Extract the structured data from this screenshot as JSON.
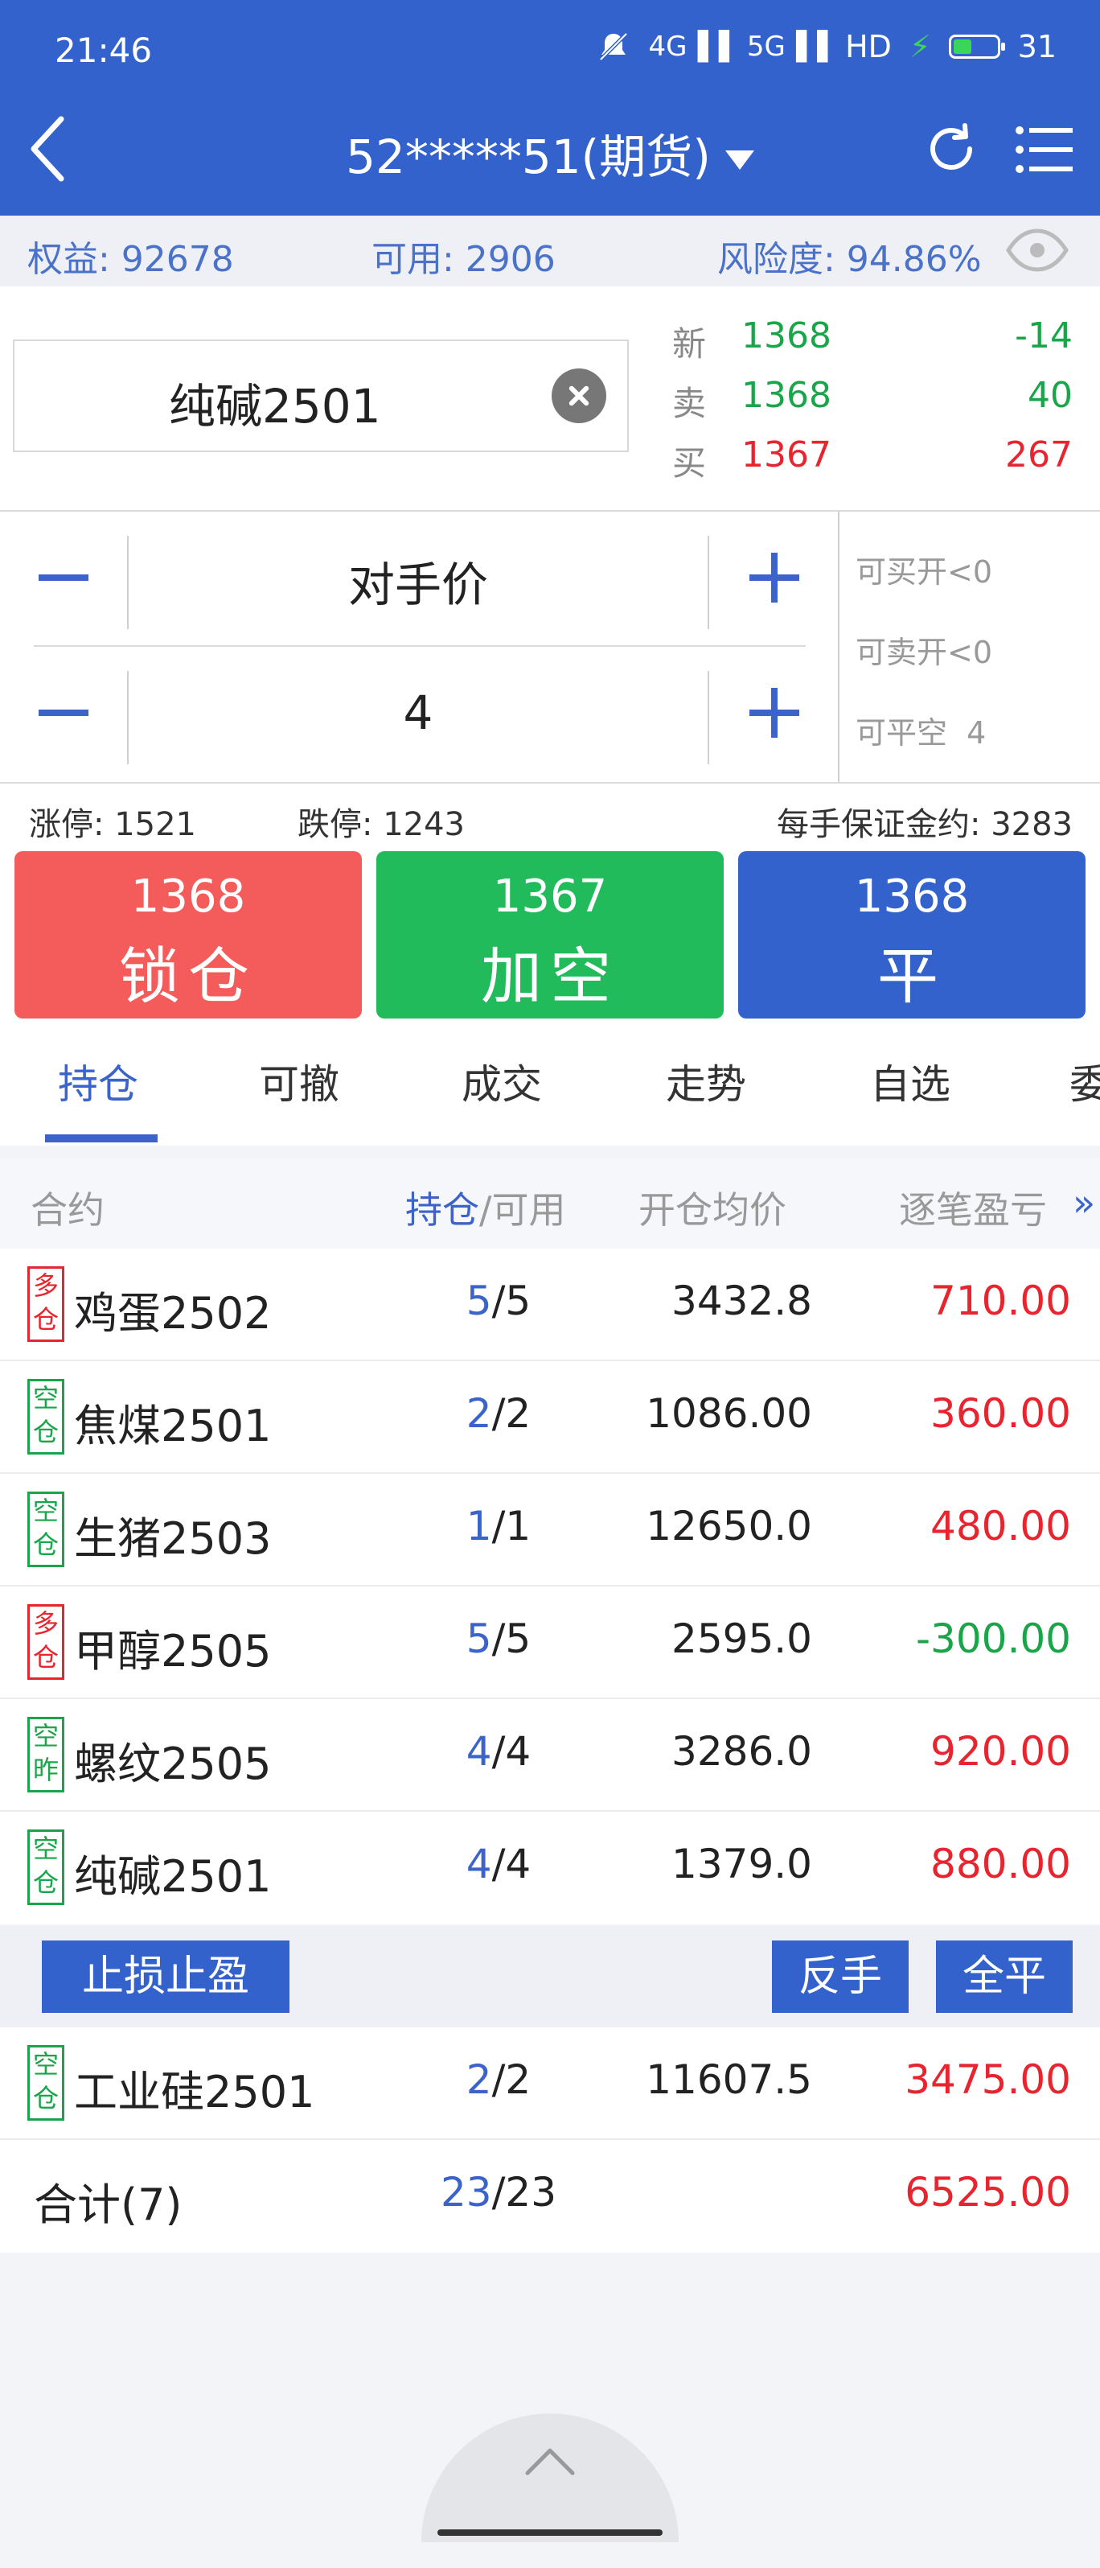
{
  "status_bar": {
    "time": "21:46",
    "network1": "4G",
    "network2": "5G",
    "hd": "HD",
    "battery": "31"
  },
  "header": {
    "title": "52*****51(期货)"
  },
  "summary": {
    "equity": "权益: 92678",
    "available": "可用: 2906",
    "risk": "风险度: 94.86%"
  },
  "contract": {
    "name": "纯碱2501"
  },
  "quote": {
    "rows": [
      {
        "label": "新",
        "price": "1368",
        "value": "-14"
      },
      {
        "label": "卖",
        "price": "1368",
        "value": "40"
      },
      {
        "label": "买",
        "price": "1367",
        "value": "267"
      }
    ]
  },
  "order": {
    "price_type": "对手价",
    "quantity": "4"
  },
  "side_info": {
    "can_buy_open": "可买开<0",
    "can_sell_open": "可卖开<0",
    "can_close_short": "可平空  4"
  },
  "limits": {
    "limit_up": "涨停: 1521",
    "limit_down": "跌停: 1243",
    "margin": "每手保证金约: 3283"
  },
  "buttons": {
    "lock": {
      "price": "1368",
      "label": "锁仓"
    },
    "add_short": {
      "price": "1367",
      "label": "加空"
    },
    "close": {
      "price": "1368",
      "label": "平"
    }
  },
  "tabs": [
    "持仓",
    "可撤",
    "成交",
    "走势",
    "自选",
    "委"
  ],
  "table": {
    "headers": {
      "contract": "合约",
      "position_highlight": "持仓",
      "position_rest": "/可用",
      "avg_price": "开仓均价",
      "pnl": "逐笔盈亏",
      "more": "»"
    },
    "rows": [
      {
        "badge": [
          "多",
          "仓"
        ],
        "dir": "long",
        "name": "鸡蛋2502",
        "pos": "5",
        "avail": "/5",
        "avg": "3432.8",
        "pnl": "710.00",
        "pnl_sign": "pos"
      },
      {
        "badge": [
          "空",
          "仓"
        ],
        "dir": "short",
        "name": "焦煤2501",
        "pos": "2",
        "avail": "/2",
        "avg": "1086.00",
        "pnl": "360.00",
        "pnl_sign": "pos"
      },
      {
        "badge": [
          "空",
          "仓"
        ],
        "dir": "short",
        "name": "生猪2503",
        "pos": "1",
        "avail": "/1",
        "avg": "12650.0",
        "pnl": "480.00",
        "pnl_sign": "pos"
      },
      {
        "badge": [
          "多",
          "仓"
        ],
        "dir": "long",
        "name": "甲醇2505",
        "pos": "5",
        "avail": "/5",
        "avg": "2595.0",
        "pnl": "-300.00",
        "pnl_sign": "neg"
      },
      {
        "badge": [
          "空",
          "昨"
        ],
        "dir": "short",
        "name": "螺纹2505",
        "pos": "4",
        "avail": "/4",
        "avg": "3286.0",
        "pnl": "920.00",
        "pnl_sign": "pos"
      },
      {
        "badge": [
          "空",
          "仓"
        ],
        "dir": "short",
        "name": "纯碱2501",
        "pos": "4",
        "avail": "/4",
        "avg": "1379.0",
        "pnl": "880.00",
        "pnl_sign": "pos"
      },
      {
        "badge": [
          "空",
          "仓"
        ],
        "dir": "short",
        "name": "工业硅2501",
        "pos": "2",
        "avail": "/2",
        "avg": "11607.5",
        "pnl": "3475.00",
        "pnl_sign": "pos"
      }
    ],
    "total": {
      "label": "合计(7)",
      "pos": "23",
      "avail": "/23",
      "pnl": "6525.00"
    }
  },
  "actions": {
    "stop": "止损止盈",
    "reverse": "反手",
    "close_all": "全平"
  },
  "colors": {
    "accent": "#3462cc",
    "red": "#e8242f",
    "green": "#1aa54a",
    "lock_btn": "#f45c5c",
    "short_btn": "#22bb5c"
  }
}
